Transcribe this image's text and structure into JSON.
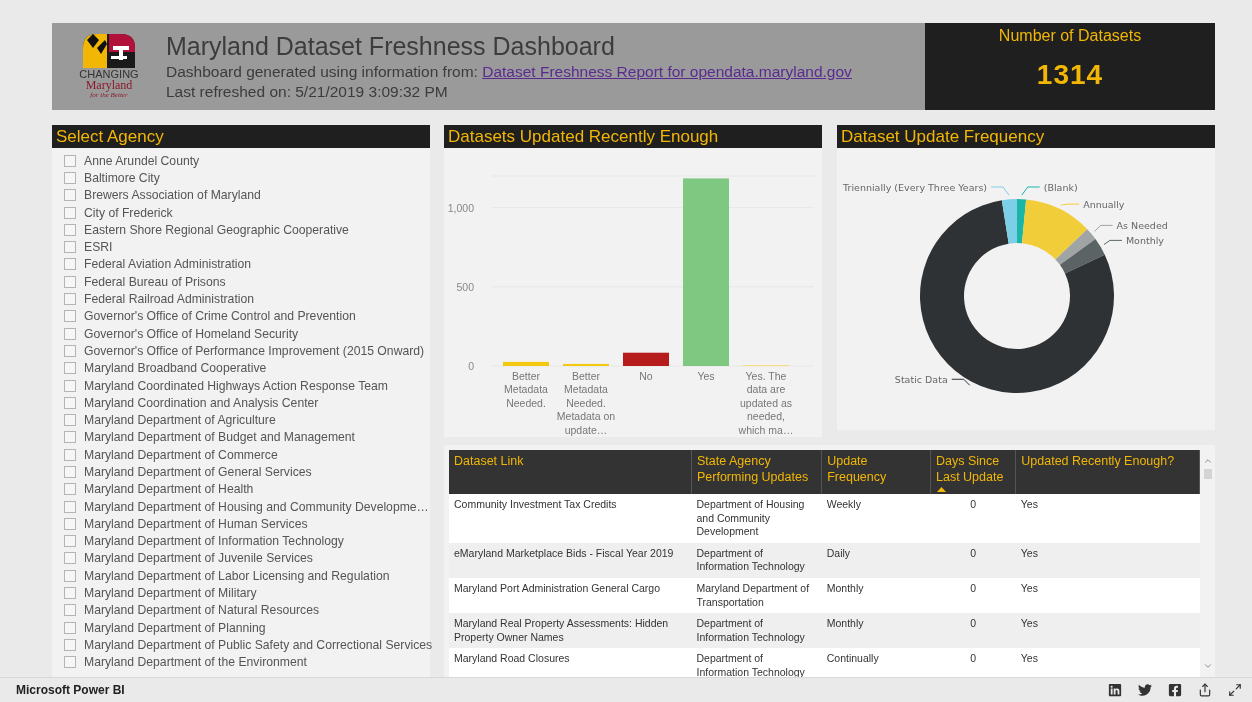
{
  "header": {
    "logo": {
      "line1": "CHANGING",
      "line2": "Maryland",
      "line3": "for the Better"
    },
    "title": "Maryland Dataset Freshness Dashboard",
    "source_prefix": "Dashboard generated using information from: ",
    "source_link": "Dataset Freshness Report for opendata.maryland.gov",
    "refreshed": "Last refreshed on: 5/21/2019 3:09:32 PM"
  },
  "dataset_count": {
    "label": "Number of Datasets",
    "value": "1314"
  },
  "agency_panel": {
    "title": "Select Agency",
    "items": [
      {
        "label": "Anne Arundel County",
        "checked": false
      },
      {
        "label": "Baltimore City",
        "checked": false
      },
      {
        "label": "Brewers Association of Maryland",
        "checked": false
      },
      {
        "label": "City of Frederick",
        "checked": false
      },
      {
        "label": "Eastern Shore Regional Geographic Cooperative",
        "checked": false
      },
      {
        "label": "ESRI",
        "checked": false
      },
      {
        "label": "Federal Aviation Administration",
        "checked": false
      },
      {
        "label": "Federal Bureau of Prisons",
        "checked": false
      },
      {
        "label": "Federal Railroad Administration",
        "checked": false
      },
      {
        "label": "Governor's Office of Crime Control and Prevention",
        "checked": false
      },
      {
        "label": "Governor's Office of Homeland Security",
        "checked": false
      },
      {
        "label": "Governor's Office of Performance Improvement (2015 Onward)",
        "checked": false
      },
      {
        "label": "Maryland Broadband Cooperative",
        "checked": false
      },
      {
        "label": "Maryland Coordinated Highways Action Response Team",
        "checked": false
      },
      {
        "label": "Maryland Coordination and Analysis Center",
        "checked": false
      },
      {
        "label": "Maryland Department of Agriculture",
        "checked": false
      },
      {
        "label": "Maryland Department of Budget and Management",
        "checked": false
      },
      {
        "label": "Maryland Department of Commerce",
        "checked": false
      },
      {
        "label": "Maryland Department of General Services",
        "checked": false
      },
      {
        "label": "Maryland Department of Health",
        "checked": false
      },
      {
        "label": "Maryland Department of Housing and Community Developme…",
        "checked": false
      },
      {
        "label": "Maryland Department of Human Services",
        "checked": false
      },
      {
        "label": "Maryland Department of Information Technology",
        "checked": false
      },
      {
        "label": "Maryland Department of Juvenile Services",
        "checked": false
      },
      {
        "label": "Maryland Department of Labor Licensing and Regulation",
        "checked": false
      },
      {
        "label": "Maryland Department of Military",
        "checked": false
      },
      {
        "label": "Maryland Department of Natural Resources",
        "checked": false
      },
      {
        "label": "Maryland Department of Planning",
        "checked": false
      },
      {
        "label": "Maryland Department of Public Safety and Correctional Services",
        "checked": false
      },
      {
        "label": "Maryland Department of the Environment",
        "checked": false
      }
    ]
  },
  "recency_chart": {
    "title": "Datasets Updated Recently Enough",
    "chart_data": {
      "type": "bar",
      "series": [
        {
          "name": "Better Metadata Needed.",
          "color": "#f2c811",
          "values": [
            26
          ]
        },
        {
          "name": "Better Metadata Needed. Metadata on update…",
          "color": "#f2c811",
          "values": [
            13
          ]
        },
        {
          "name": "No",
          "color": "#b71c1c",
          "values": [
            84
          ]
        },
        {
          "name": "Yes",
          "color": "#7fc882",
          "values": [
            1185
          ]
        },
        {
          "name": "Yes. The data are updated as needed, which ma…",
          "color": "#f5dd80",
          "values": [
            6
          ]
        }
      ],
      "ylim": [
        0,
        1200
      ],
      "yticks": [
        0,
        {
          "value": 500,
          "label": "500"
        },
        {
          "value": 1000,
          "label": "1,000"
        }
      ]
    }
  },
  "frequency_chart": {
    "title": "Dataset Update Frequency",
    "chart_data": {
      "type": "donut",
      "categories": [
        "(Blank)",
        "Annually",
        "As Needed",
        "Monthly",
        "Static Data",
        "Triennially (Every Three Years)"
      ],
      "series": [
        {
          "color": [
            "#1bb5a8",
            "#f2cd3a",
            "#a0a4a4",
            "#5c6365",
            "#2f3234",
            "#7dcfe8"
          ],
          "values": [
            1.5,
            11.4,
            2.1,
            3.0,
            79.5,
            2.5
          ]
        }
      ]
    }
  },
  "table": {
    "columns": [
      {
        "label": "Dataset Link",
        "sorted": false
      },
      {
        "label": "State Agency Performing Updates",
        "sorted": false
      },
      {
        "label": "Update Frequency",
        "sorted": false
      },
      {
        "label": "Days Since Last Update",
        "sorted": true
      },
      {
        "label": "Updated Recently Enough?",
        "sorted": false
      }
    ],
    "rows": [
      [
        "Community Investment Tax Credits",
        "Department of Housing and Community Development",
        "Weekly",
        "0",
        "Yes"
      ],
      [
        "eMaryland Marketplace Bids - Fiscal Year 2019",
        "Department of Information Technology",
        "Daily",
        "0",
        "Yes"
      ],
      [
        "Maryland Port Administration General Cargo",
        "Maryland Department of Transportation",
        "Monthly",
        "0",
        "Yes"
      ],
      [
        "Maryland Real Property Assessments: Hidden Property Owner Names",
        "Department of Information Technology",
        "Monthly",
        "0",
        "Yes"
      ],
      [
        "Maryland Road Closures",
        "Department of Information Technology",
        "Continually",
        "0",
        "Yes"
      ]
    ]
  },
  "footer": {
    "brand": "Microsoft Power BI"
  }
}
